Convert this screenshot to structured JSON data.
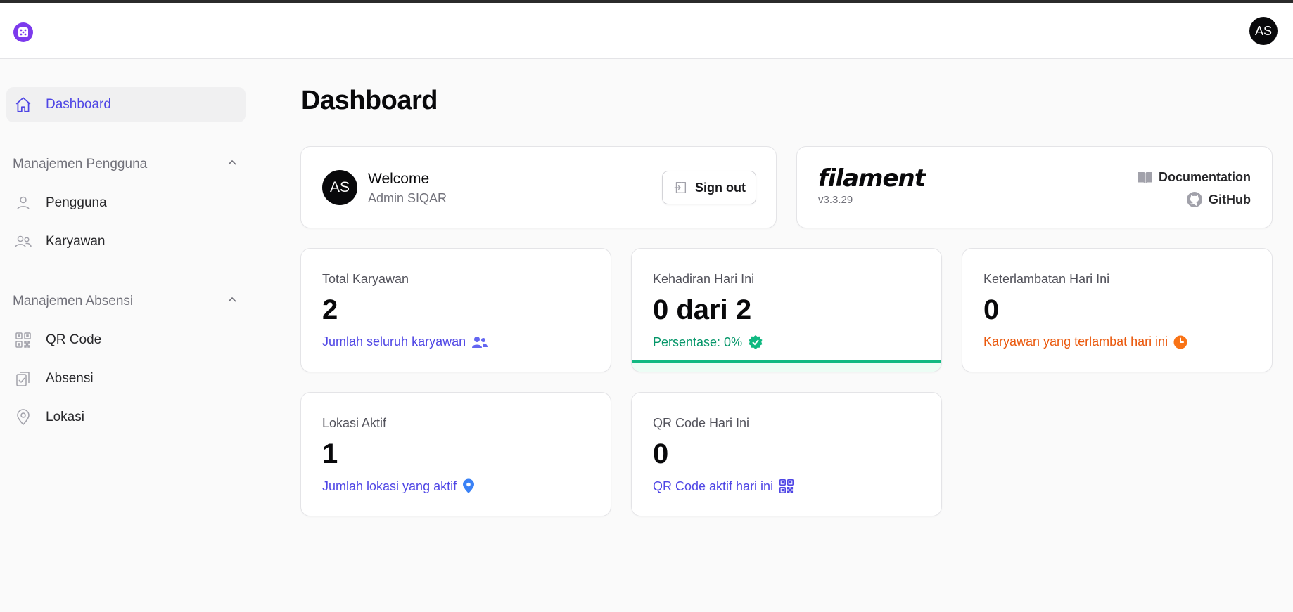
{
  "header": {
    "user_initials": "AS"
  },
  "sidebar": {
    "dashboard_label": "Dashboard",
    "groups": [
      {
        "label": "Manajemen Pengguna",
        "items": [
          {
            "label": "Pengguna"
          },
          {
            "label": "Karyawan"
          }
        ]
      },
      {
        "label": "Manajemen Absensi",
        "items": [
          {
            "label": "QR Code"
          },
          {
            "label": "Absensi"
          },
          {
            "label": "Lokasi"
          }
        ]
      }
    ]
  },
  "page": {
    "title": "Dashboard"
  },
  "welcome": {
    "initials": "AS",
    "title": "Welcome",
    "name": "Admin SIQAR",
    "signout_label": "Sign out"
  },
  "filament": {
    "logo_text": "filament",
    "version": "v3.3.29",
    "documentation_label": "Documentation",
    "github_label": "GitHub"
  },
  "stats": {
    "total_karyawan": {
      "label": "Total Karyawan",
      "value": "2",
      "description": "Jumlah seluruh karyawan",
      "color": "#4f46e5"
    },
    "kehadiran": {
      "label": "Kehadiran Hari Ini",
      "value": "0 dari 2",
      "description": "Persentase: 0%",
      "color": "#059669"
    },
    "keterlambatan": {
      "label": "Keterlambatan Hari Ini",
      "value": "0",
      "description": "Karyawan yang terlambat hari ini",
      "color": "#ea580c"
    },
    "lokasi": {
      "label": "Lokasi Aktif",
      "value": "1",
      "description": "Jumlah lokasi yang aktif",
      "color": "#4f46e5"
    },
    "qr_code": {
      "label": "QR Code Hari Ini",
      "value": "0",
      "description": "QR Code aktif hari ini",
      "color": "#4f46e5"
    }
  },
  "colors": {
    "primary": "#4f46e5",
    "success": "#10b981",
    "warning": "#ea580c",
    "brand": "#7c3aed"
  }
}
